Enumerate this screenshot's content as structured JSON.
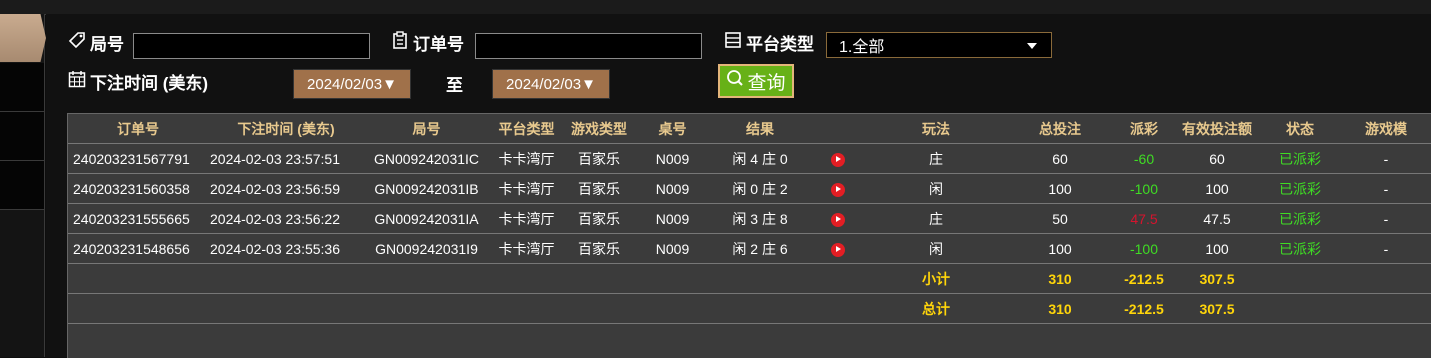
{
  "filters": {
    "round_label": "局号",
    "round_value": "",
    "order_label": "订单号",
    "order_value": "",
    "platform_label": "平台类型",
    "platform_selected": "1.全部",
    "time_label": "下注时间 (美东)",
    "date_from": "2024/02/03",
    "to_label": "至",
    "date_to": "2024/02/03",
    "query_label": "查询"
  },
  "table": {
    "headers": [
      "订单号",
      "下注时间 (美东)",
      "局号",
      "平台类型",
      "游戏类型",
      "桌号",
      "结果",
      "",
      "玩法",
      "总投注",
      "派彩",
      "有效投注额",
      "状态",
      "游戏模"
    ],
    "rows": [
      {
        "order": "240203231567791",
        "time": "2024-02-03 23:57:51",
        "round": "GN009242031IC",
        "platform": "卡卡湾厅",
        "game": "百家乐",
        "table": "N009",
        "result": "闲 4 庄 0",
        "play": "庄",
        "bet": "60",
        "payout": "-60",
        "payout_color": "green",
        "valid": "60",
        "status": "已派彩",
        "mode": "-"
      },
      {
        "order": "240203231560358",
        "time": "2024-02-03 23:56:59",
        "round": "GN009242031IB",
        "platform": "卡卡湾厅",
        "game": "百家乐",
        "table": "N009",
        "result": "闲 0 庄 2",
        "play": "闲",
        "bet": "100",
        "payout": "-100",
        "payout_color": "green",
        "valid": "100",
        "status": "已派彩",
        "mode": "-"
      },
      {
        "order": "240203231555665",
        "time": "2024-02-03 23:56:22",
        "round": "GN009242031IA",
        "platform": "卡卡湾厅",
        "game": "百家乐",
        "table": "N009",
        "result": "闲 3 庄 8",
        "play": "庄",
        "bet": "50",
        "payout": "47.5",
        "payout_color": "red",
        "valid": "47.5",
        "status": "已派彩",
        "mode": "-"
      },
      {
        "order": "240203231548656",
        "time": "2024-02-03 23:55:36",
        "round": "GN009242031I9",
        "platform": "卡卡湾厅",
        "game": "百家乐",
        "table": "N009",
        "result": "闲 2 庄 6",
        "play": "闲",
        "bet": "100",
        "payout": "-100",
        "payout_color": "green",
        "valid": "100",
        "status": "已派彩",
        "mode": "-"
      }
    ],
    "subtotal": {
      "label": "小计",
      "bet": "310",
      "payout": "-212.5",
      "valid": "307.5"
    },
    "total": {
      "label": "总计",
      "bet": "310",
      "payout": "-212.5",
      "valid": "307.5"
    }
  },
  "colors": {
    "status_green": "#3fdc24",
    "loss_red": "#d4142e",
    "summary_yellow": "#ffd50a",
    "header_gold": "#e8c98e",
    "query_green": "#67b117"
  },
  "icons": {
    "round": "tag-icon",
    "order": "clipboard-icon",
    "platform": "list-icon",
    "time": "calendar-icon",
    "query": "search-icon",
    "video": "play-video-icon"
  }
}
